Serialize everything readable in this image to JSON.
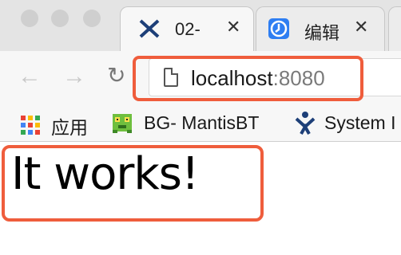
{
  "tabs": [
    {
      "title": "02-",
      "icon": "jira-logo-icon",
      "close": "✕"
    },
    {
      "title": "编辑",
      "icon": "editor-favicon-icon",
      "close": "✕"
    }
  ],
  "toolbar": {
    "back": "←",
    "forward": "→",
    "reload": "↻",
    "url_host": "localhost",
    "url_port": ":8080"
  },
  "bookmarks": [
    {
      "label": "应用",
      "icon": "apps-grid-icon"
    },
    {
      "label": "BG- MantisBT",
      "icon": "mantis-icon"
    },
    {
      "label": "System I",
      "icon": "jira-logo-icon"
    }
  ],
  "content": {
    "text": "It works!"
  },
  "colors": {
    "highlight": "#ef5d3c",
    "tab_strip": "#e4e4e4",
    "toolbar": "#f7f7f7"
  }
}
